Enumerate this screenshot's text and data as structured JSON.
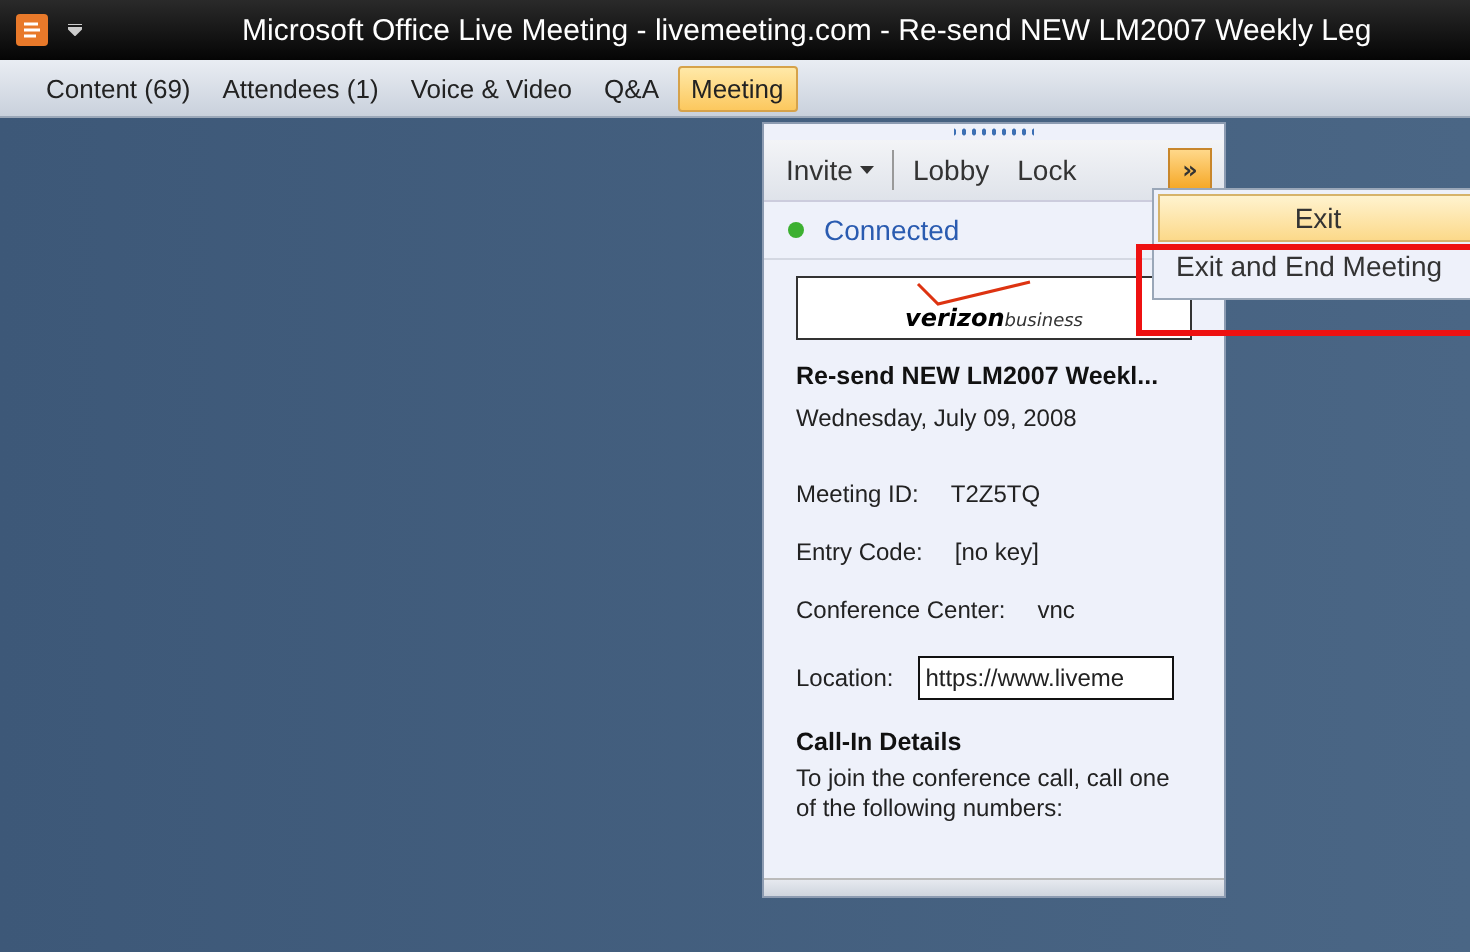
{
  "window": {
    "title": "Microsoft Office Live Meeting - livemeeting.com - Re-send NEW LM2007 Weekly Leg"
  },
  "menu": [
    {
      "label": "Content (69)",
      "selected": false
    },
    {
      "label": "Attendees (1)",
      "selected": false
    },
    {
      "label": "Voice & Video",
      "selected": false
    },
    {
      "label": "Q&A",
      "selected": false
    },
    {
      "label": "Meeting",
      "selected": true
    }
  ],
  "panel": {
    "toolbar": {
      "invite": "Invite",
      "lobby": "Lobby",
      "lock": "Lock",
      "more": "»"
    },
    "status": {
      "label": "Connected",
      "color": "#3cb030"
    },
    "logo": {
      "word": "verizon",
      "suffix": "business"
    },
    "meeting_title": "Re-send NEW LM2007 Weekl...",
    "date": "Wednesday, July 09, 2008",
    "fields": [
      {
        "label": "Meeting ID:",
        "value": "T2Z5TQ"
      },
      {
        "label": "Entry Code:",
        "value": "[no key]"
      },
      {
        "label": "Conference Center:",
        "value": "vnc"
      }
    ],
    "location": {
      "label": "Location:",
      "value": "https://www.liveme"
    },
    "callin_heading": "Call-In Details",
    "callin_text": "To join the conference call, call one of the following numbers:"
  },
  "dropdown": [
    {
      "label": "Exit",
      "selected": true,
      "highlighted": false
    },
    {
      "label": "Exit and End Meeting",
      "selected": false,
      "highlighted": true
    }
  ]
}
